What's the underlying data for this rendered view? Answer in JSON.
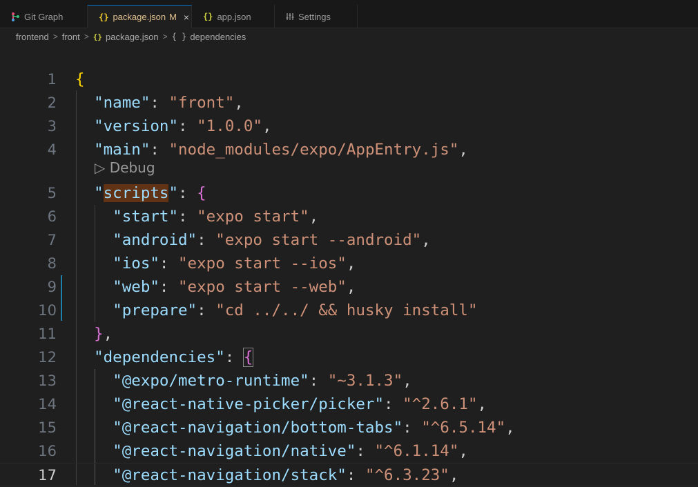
{
  "tabs": [
    {
      "label": "Git Graph",
      "icon": "git-graph-icon",
      "active": false
    },
    {
      "label": "package.json",
      "icon": "json-icon",
      "active": true,
      "status": "M",
      "close": "×"
    },
    {
      "label": "app.json",
      "icon": "json-icon",
      "active": false
    },
    {
      "label": "Settings",
      "icon": "settings-sliders-icon",
      "active": false
    }
  ],
  "breadcrumb": {
    "parts": [
      "frontend",
      "front",
      "package.json",
      "dependencies"
    ],
    "separator": ">",
    "json_icon_glyph": "{}",
    "object_icon_glyph": "{ }"
  },
  "codelens": {
    "label": "Debug",
    "glyph": "▷"
  },
  "editor": {
    "current_line": 17,
    "lines": [
      {
        "n": "1",
        "segs": [
          [
            "b1",
            "{"
          ]
        ]
      },
      {
        "n": "2",
        "segs": [
          [
            "p",
            "  "
          ],
          [
            "k",
            "\"name\""
          ],
          [
            "p",
            ": "
          ],
          [
            "s",
            "\"front\""
          ],
          [
            "p",
            ","
          ]
        ]
      },
      {
        "n": "3",
        "segs": [
          [
            "p",
            "  "
          ],
          [
            "k",
            "\"version\""
          ],
          [
            "p",
            ": "
          ],
          [
            "s",
            "\"1.0.0\""
          ],
          [
            "p",
            ","
          ]
        ]
      },
      {
        "n": "4",
        "segs": [
          [
            "p",
            "  "
          ],
          [
            "k",
            "\"main\""
          ],
          [
            "p",
            ": "
          ],
          [
            "s",
            "\"node_modules/expo/AppEntry.js\""
          ],
          [
            "p",
            ","
          ]
        ]
      },
      {
        "n": "5",
        "segs": [
          [
            "p",
            "  "
          ],
          [
            "k",
            "\""
          ],
          [
            "khl",
            "scripts"
          ],
          [
            "k",
            "\""
          ],
          [
            "p",
            ": "
          ],
          [
            "b2",
            "{"
          ]
        ]
      },
      {
        "n": "6",
        "segs": [
          [
            "p",
            "    "
          ],
          [
            "k",
            "\"start\""
          ],
          [
            "p",
            ": "
          ],
          [
            "s",
            "\"expo start\""
          ],
          [
            "p",
            ","
          ]
        ]
      },
      {
        "n": "7",
        "segs": [
          [
            "p",
            "    "
          ],
          [
            "k",
            "\"android\""
          ],
          [
            "p",
            ": "
          ],
          [
            "s",
            "\"expo start --android\""
          ],
          [
            "p",
            ","
          ]
        ]
      },
      {
        "n": "8",
        "segs": [
          [
            "p",
            "    "
          ],
          [
            "k",
            "\"ios\""
          ],
          [
            "p",
            ": "
          ],
          [
            "s",
            "\"expo start --ios\""
          ],
          [
            "p",
            ","
          ]
        ]
      },
      {
        "n": "9",
        "segs": [
          [
            "p",
            "    "
          ],
          [
            "k",
            "\"web\""
          ],
          [
            "p",
            ": "
          ],
          [
            "s",
            "\"expo start --web\""
          ],
          [
            "p",
            ","
          ]
        ]
      },
      {
        "n": "10",
        "segs": [
          [
            "p",
            "    "
          ],
          [
            "k",
            "\"prepare\""
          ],
          [
            "p",
            ": "
          ],
          [
            "s",
            "\"cd ../../ && husky install\""
          ]
        ]
      },
      {
        "n": "11",
        "segs": [
          [
            "p",
            "  "
          ],
          [
            "b2",
            "}"
          ],
          [
            "p",
            ","
          ]
        ]
      },
      {
        "n": "12",
        "segs": [
          [
            "p",
            "  "
          ],
          [
            "k",
            "\"dependencies\""
          ],
          [
            "p",
            ": "
          ],
          [
            "b2box",
            "{"
          ]
        ]
      },
      {
        "n": "13",
        "segs": [
          [
            "p",
            "    "
          ],
          [
            "k",
            "\"@expo/metro-runtime\""
          ],
          [
            "p",
            ": "
          ],
          [
            "s",
            "\"~3.1.3\""
          ],
          [
            "p",
            ","
          ]
        ]
      },
      {
        "n": "14",
        "segs": [
          [
            "p",
            "    "
          ],
          [
            "k",
            "\"@react-native-picker/picker\""
          ],
          [
            "p",
            ": "
          ],
          [
            "s",
            "\"^2.6.1\""
          ],
          [
            "p",
            ","
          ]
        ]
      },
      {
        "n": "15",
        "segs": [
          [
            "p",
            "    "
          ],
          [
            "k",
            "\"@react-navigation/bottom-tabs\""
          ],
          [
            "p",
            ": "
          ],
          [
            "s",
            "\"^6.5.14\""
          ],
          [
            "p",
            ","
          ]
        ]
      },
      {
        "n": "16",
        "segs": [
          [
            "p",
            "    "
          ],
          [
            "k",
            "\"@react-navigation/native\""
          ],
          [
            "p",
            ": "
          ],
          [
            "s",
            "\"^6.1.14\""
          ],
          [
            "p",
            ","
          ]
        ]
      },
      {
        "n": "17",
        "segs": [
          [
            "p",
            "    "
          ],
          [
            "k",
            "\"@react-navigation/stack\""
          ],
          [
            "p",
            ": "
          ],
          [
            "s",
            "\"^6.3.23\""
          ],
          [
            "p",
            ","
          ]
        ]
      }
    ]
  }
}
